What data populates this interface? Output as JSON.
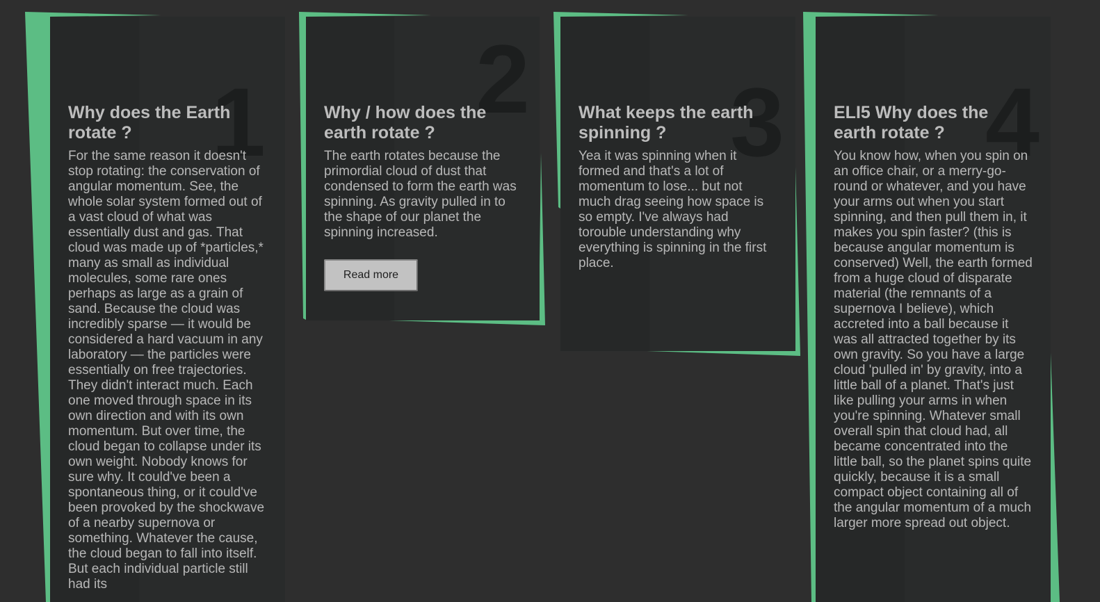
{
  "cards": [
    {
      "number": "1",
      "title": "Why does the Earth rotate ?",
      "body": "For the same reason it doesn't stop rotating: the conservation of angular momentum. See, the whole solar system formed out of a vast cloud of what was essentially dust and gas. That cloud was made up of *particles,* many as small as individual molecules, some rare ones perhaps as large as a grain of sand. Because the cloud was incredibly sparse — it would be considered a hard vacuum in any laboratory — the particles were essentially on free trajectories. They didn't interact much. Each one moved through space in its own direction and with its own momentum. But over time, the cloud began to collapse under its own weight. Nobody knows for sure why. It could've been a spontaneous thing, or it could've been provoked by the shockwave of a nearby supernova or something. Whatever the cause, the cloud began to fall into itself. But each individual particle still had its"
    },
    {
      "number": "2",
      "title": "Why / how does the earth rotate ?",
      "body": "The earth rotates because the primordial cloud of dust that condensed to form the earth was spinning. As gravity pulled in to the shape of our planet the spinning increased.",
      "button_label": "Read more"
    },
    {
      "number": "3",
      "title": "What keeps the earth spinning ?",
      "body": "Yea it was spinning when it formed and that's a lot of momentum to lose... but not much drag seeing how space is so empty. I've always had torouble understanding why everything is spinning in the first place."
    },
    {
      "number": "4",
      "title": "ELI5 Why does the earth rotate ?",
      "body": "You know how, when you spin on an office chair, or a merry-go-round or whatever, and you have your arms out when you start spinning, and then pull them in, it makes you spin faster? (this is because angular momentum is conserved) Well, the earth formed from a huge cloud of disparate material (the remnants of a supernova I believe), which accreted into a ball because it was all attracted together by its own gravity. So you have a large cloud 'pulled in' by gravity, into a little ball of a planet. That's just like pulling your arms in when you're spinning. Whatever small overall spin that cloud had, all became concentrated into the little ball, so the planet spins quite quickly, because it is a small compact object containing all of the angular momentum of a much larger more spread out object."
    }
  ],
  "colors": {
    "background": "#2e2e2e",
    "card": "#282a2a",
    "accent": "#5cbd84",
    "number": "#1c1e1e",
    "title": "#bdbdbd",
    "text": "#b8b8b8",
    "button": "#c2c2c2"
  }
}
